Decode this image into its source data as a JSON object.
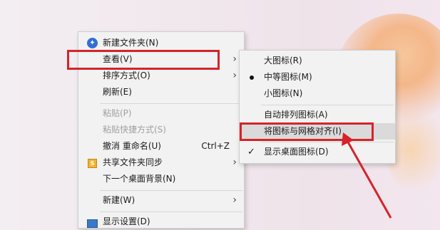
{
  "context_menu": {
    "items": [
      {
        "label": "新建文件夹(N)",
        "icon": "new-folder-icon"
      },
      {
        "label": "查看(V)",
        "has_submenu": true,
        "highlighted": true
      },
      {
        "label": "排序方式(O)",
        "has_submenu": true
      },
      {
        "label": "刷新(E)"
      },
      {
        "label": "粘贴(P)",
        "disabled": true
      },
      {
        "label": "粘贴快捷方式(S)",
        "disabled": true
      },
      {
        "label": "撤消 重命名(U)",
        "shortcut": "Ctrl+Z"
      },
      {
        "label": "共享文件夹同步",
        "icon": "sync-icon",
        "has_submenu": true
      },
      {
        "label": "下一个桌面背景(N)"
      },
      {
        "label": "新建(W)",
        "has_submenu": true
      },
      {
        "label": "显示设置(D)",
        "icon": "display-settings-icon"
      }
    ]
  },
  "view_submenu": {
    "items": [
      {
        "label": "大图标(R)"
      },
      {
        "label": "中等图标(M)",
        "selected": true
      },
      {
        "label": "小图标(N)"
      },
      {
        "label": "自动排列图标(A)"
      },
      {
        "label": "将图标与网格对齐(I)",
        "highlighted": true
      },
      {
        "label": "显示桌面图标(D)",
        "checked": true
      }
    ]
  },
  "glyphs": {
    "submenu_arrow": "›",
    "check": "✓",
    "new_folder": "✦",
    "sync": "S"
  },
  "colors": {
    "annotation_red": "#d4232b",
    "menu_bg": "#f2f2f2",
    "hover_bg": "#dadada"
  }
}
